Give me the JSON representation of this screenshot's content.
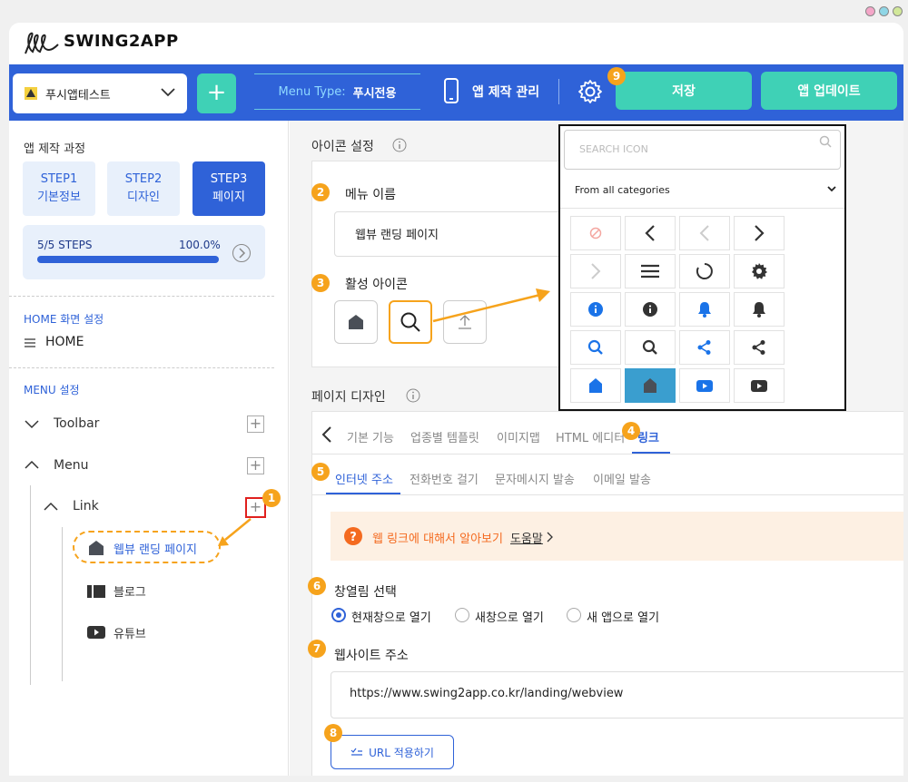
{
  "brand": {
    "name": "SWING2APP"
  },
  "topbar": {
    "app_name": "푸시앱테스트",
    "menu_type_label": "Menu Type:",
    "menu_type_value": "푸시전용",
    "app_manage": "앱 제작 관리",
    "save": "저장",
    "update": "앱 업데이트"
  },
  "sidebar": {
    "process_title": "앱 제작 과정",
    "steps": [
      {
        "line1": "STEP1",
        "line2": "기본정보"
      },
      {
        "line1": "STEP2",
        "line2": "디자인"
      },
      {
        "line1": "STEP3",
        "line2": "페이지"
      }
    ],
    "progress_label": "5/5 STEPS",
    "progress_percent": "100.0%",
    "progress_value": 1.0,
    "home_section": "HOME 화면 설정",
    "home_item": "HOME",
    "menu_section": "MENU 설정",
    "tree": {
      "toolbar": "Toolbar",
      "menu": "Menu",
      "link": "Link",
      "children": [
        "웹뷰 랜딩 페이지",
        "블로그",
        "유튜브"
      ]
    }
  },
  "icon_settings": {
    "title": "아이콘 설정",
    "menu_name_label": "메뉴 이름",
    "menu_name_value": "웹뷰 랜딩 페이지",
    "active_icon_label": "활성 아이콘"
  },
  "icon_picker": {
    "search_placeholder": "SEARCH ICON",
    "category": "From all categories"
  },
  "page_design": {
    "title": "페이지 디자인",
    "tabs": [
      "기본 기능",
      "업종별 템플릿",
      "이미지맵",
      "HTML 에디터",
      "링크"
    ],
    "subtabs": [
      "인터넷 주소",
      "전화번호 걸기",
      "문자메시지 발송",
      "이메일 발송"
    ],
    "help_text": "웹 링크에 대해서 알아보기",
    "help_link": "도움말",
    "window_label": "창열림 선택",
    "window_options": [
      "현재창으로 열기",
      "새창으로 열기",
      "새 앱으로 열기"
    ],
    "site_label": "웹사이트 주소",
    "site_url": "https://www.swing2app.co.kr/landing/webview",
    "apply_url": "URL 적용하기"
  },
  "badges": [
    "1",
    "2",
    "3",
    "4",
    "5",
    "6",
    "7",
    "8",
    "9"
  ],
  "colors": {
    "primary": "#2f62d8",
    "teal": "#3fd1b6",
    "accent": "#f6a31c",
    "red": "#e0201e",
    "icon_blue": "#1a73e8"
  }
}
